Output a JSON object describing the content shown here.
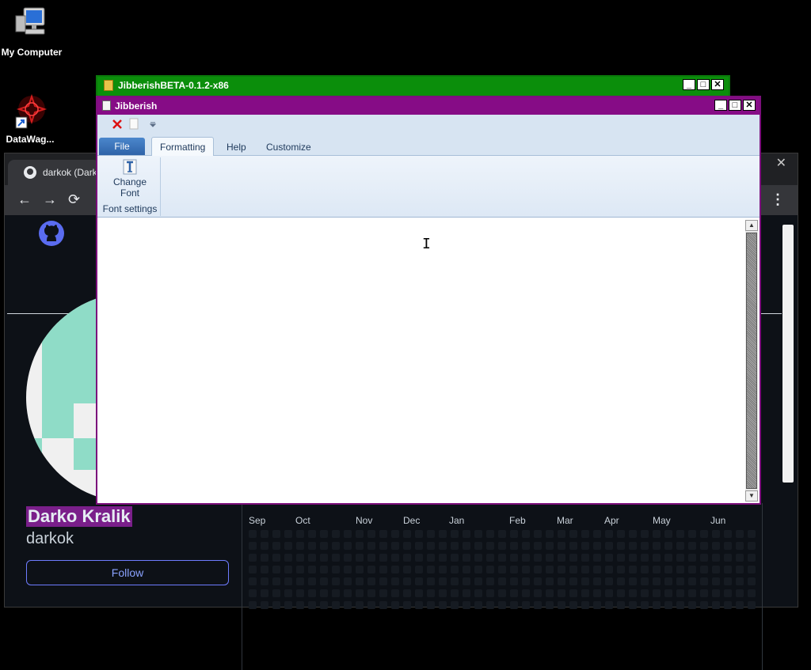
{
  "desktop": {
    "icons": [
      {
        "label": "My Computer",
        "icon": "computer-icon"
      },
      {
        "label": "DataWag...",
        "icon": "datawag-shortcut-icon"
      }
    ]
  },
  "browser": {
    "tab_title": "darkok (Darko",
    "close_glyph": "✕",
    "nav": {
      "back": "←",
      "forward": "→",
      "reload": "⟳",
      "menu": "⋮"
    },
    "profile": {
      "name": "Darko Kralik",
      "login": "darkok",
      "follow_label": "Follow"
    },
    "contributions": {
      "months": [
        "Sep",
        "Oct",
        "Nov",
        "Dec",
        "Jan",
        "Feb",
        "Mar",
        "Apr",
        "May",
        "Jun"
      ]
    }
  },
  "outer_window": {
    "title": "JibberishBETA-0.1.2-x86",
    "buttons": {
      "minimize": "_",
      "maximize": "□",
      "close": "✕"
    }
  },
  "main_window": {
    "title": "Jibberish",
    "buttons": {
      "minimize": "_",
      "maximize": "□",
      "close": "✕"
    },
    "ribbon": {
      "tabs": [
        {
          "label": "File"
        },
        {
          "label": "Formatting"
        },
        {
          "label": "Help"
        },
        {
          "label": "Customize"
        }
      ],
      "group": {
        "button_label_line1": "Change",
        "button_label_line2": "Font",
        "group_label": "Font settings"
      }
    },
    "editor": {
      "content": ""
    }
  },
  "colors": {
    "outer_titlebar": "#0b8e0b",
    "main_titlebar": "#860c86",
    "ribbon_bg": "#d7e4f2",
    "file_tab": "#2f63a8",
    "profile_name_highlight": "#7a1f8a"
  }
}
